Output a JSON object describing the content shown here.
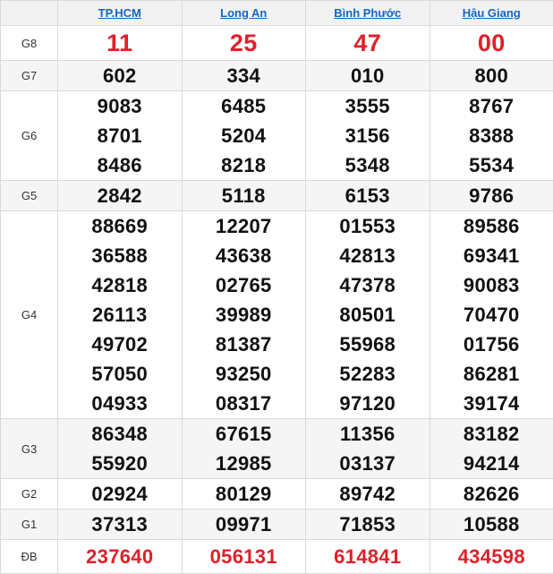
{
  "provinces": [
    "TP.HCM",
    "Long An",
    "Bình Phước",
    "Hậu Giang"
  ],
  "prizes": [
    {
      "label": "G8",
      "values": [
        [
          "11"
        ],
        [
          "25"
        ],
        [
          "47"
        ],
        [
          "00"
        ]
      ]
    },
    {
      "label": "G7",
      "values": [
        [
          "602"
        ],
        [
          "334"
        ],
        [
          "010"
        ],
        [
          "800"
        ]
      ]
    },
    {
      "label": "G6",
      "values": [
        [
          "9083",
          "8701",
          "8486"
        ],
        [
          "6485",
          "5204",
          "8218"
        ],
        [
          "3555",
          "3156",
          "5348"
        ],
        [
          "8767",
          "8388",
          "5534"
        ]
      ]
    },
    {
      "label": "G5",
      "values": [
        [
          "2842"
        ],
        [
          "5118"
        ],
        [
          "6153"
        ],
        [
          "9786"
        ]
      ]
    },
    {
      "label": "G4",
      "values": [
        [
          "88669",
          "36588",
          "42818",
          "26113",
          "49702",
          "57050",
          "04933"
        ],
        [
          "12207",
          "43638",
          "02765",
          "39989",
          "81387",
          "93250",
          "08317"
        ],
        [
          "01553",
          "42813",
          "47378",
          "80501",
          "55968",
          "52283",
          "97120"
        ],
        [
          "89586",
          "69341",
          "90083",
          "70470",
          "01756",
          "86281",
          "39174"
        ]
      ]
    },
    {
      "label": "G3",
      "values": [
        [
          "86348",
          "55920"
        ],
        [
          "67615",
          "12985"
        ],
        [
          "11356",
          "03137"
        ],
        [
          "83182",
          "94214"
        ]
      ]
    },
    {
      "label": "G2",
      "values": [
        [
          "02924"
        ],
        [
          "80129"
        ],
        [
          "89742"
        ],
        [
          "82626"
        ]
      ]
    },
    {
      "label": "G1",
      "values": [
        [
          "37313"
        ],
        [
          "09971"
        ],
        [
          "71853"
        ],
        [
          "10588"
        ]
      ]
    },
    {
      "label": "ĐB",
      "values": [
        [
          "237640"
        ],
        [
          "056131"
        ],
        [
          "614841"
        ],
        [
          "434598"
        ]
      ]
    }
  ],
  "colors": {
    "highlight": "#e0202a",
    "link": "#1565c0",
    "text": "#111111",
    "stripe": "#f5f5f5",
    "border": "#d9d9d9"
  }
}
